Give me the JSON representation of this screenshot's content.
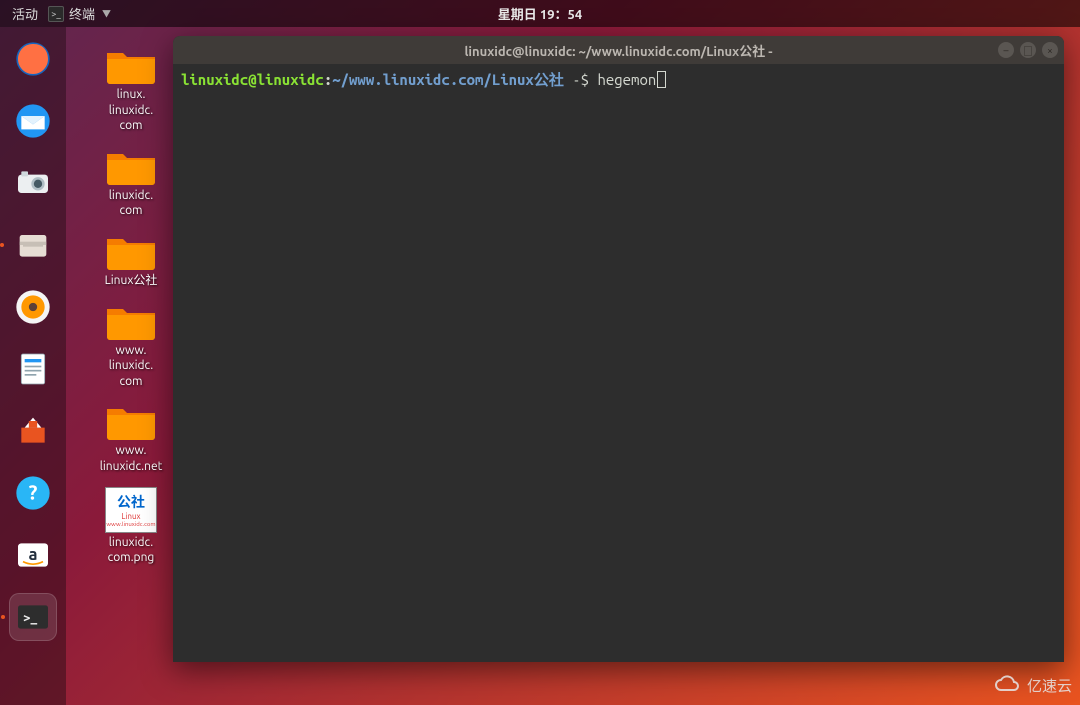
{
  "topbar": {
    "activities": "活动",
    "app_label": "终端",
    "clock": "星期日 19：54"
  },
  "dock": {
    "items": [
      {
        "name": "firefox-icon"
      },
      {
        "name": "thunderbird-icon"
      },
      {
        "name": "camera-icon"
      },
      {
        "name": "files-icon"
      },
      {
        "name": "rhythmbox-icon"
      },
      {
        "name": "libreoffice-writer-icon"
      },
      {
        "name": "software-center-icon"
      },
      {
        "name": "help-icon"
      },
      {
        "name": "amazon-icon"
      },
      {
        "name": "terminal-icon"
      }
    ]
  },
  "desktop": {
    "icons": [
      {
        "label": "linux.\nlinuxidc.\ncom"
      },
      {
        "label": "linuxidc.\ncom"
      },
      {
        "label": "Linux公社"
      },
      {
        "label": "www.\nlinuxidc.\ncom"
      },
      {
        "label": "www.\nlinuxidc.net"
      },
      {
        "label": "linuxidc.\ncom.png"
      }
    ],
    "png_thumb": {
      "t1": "公社",
      "t2": "Linux",
      "t3": "www.linuxidc.com"
    }
  },
  "terminal": {
    "title": "linuxidc@linuxidc: ~/www.linuxidc.com/Linux公社 -",
    "user": "linuxidc",
    "at": "@",
    "host": "linuxidc",
    "colon": ":",
    "path": "~/www.linuxidc.com/Linux公社",
    "prompt_suffix": " -$ ",
    "command": "hegemon"
  },
  "watermark": {
    "text": "亿速云"
  }
}
